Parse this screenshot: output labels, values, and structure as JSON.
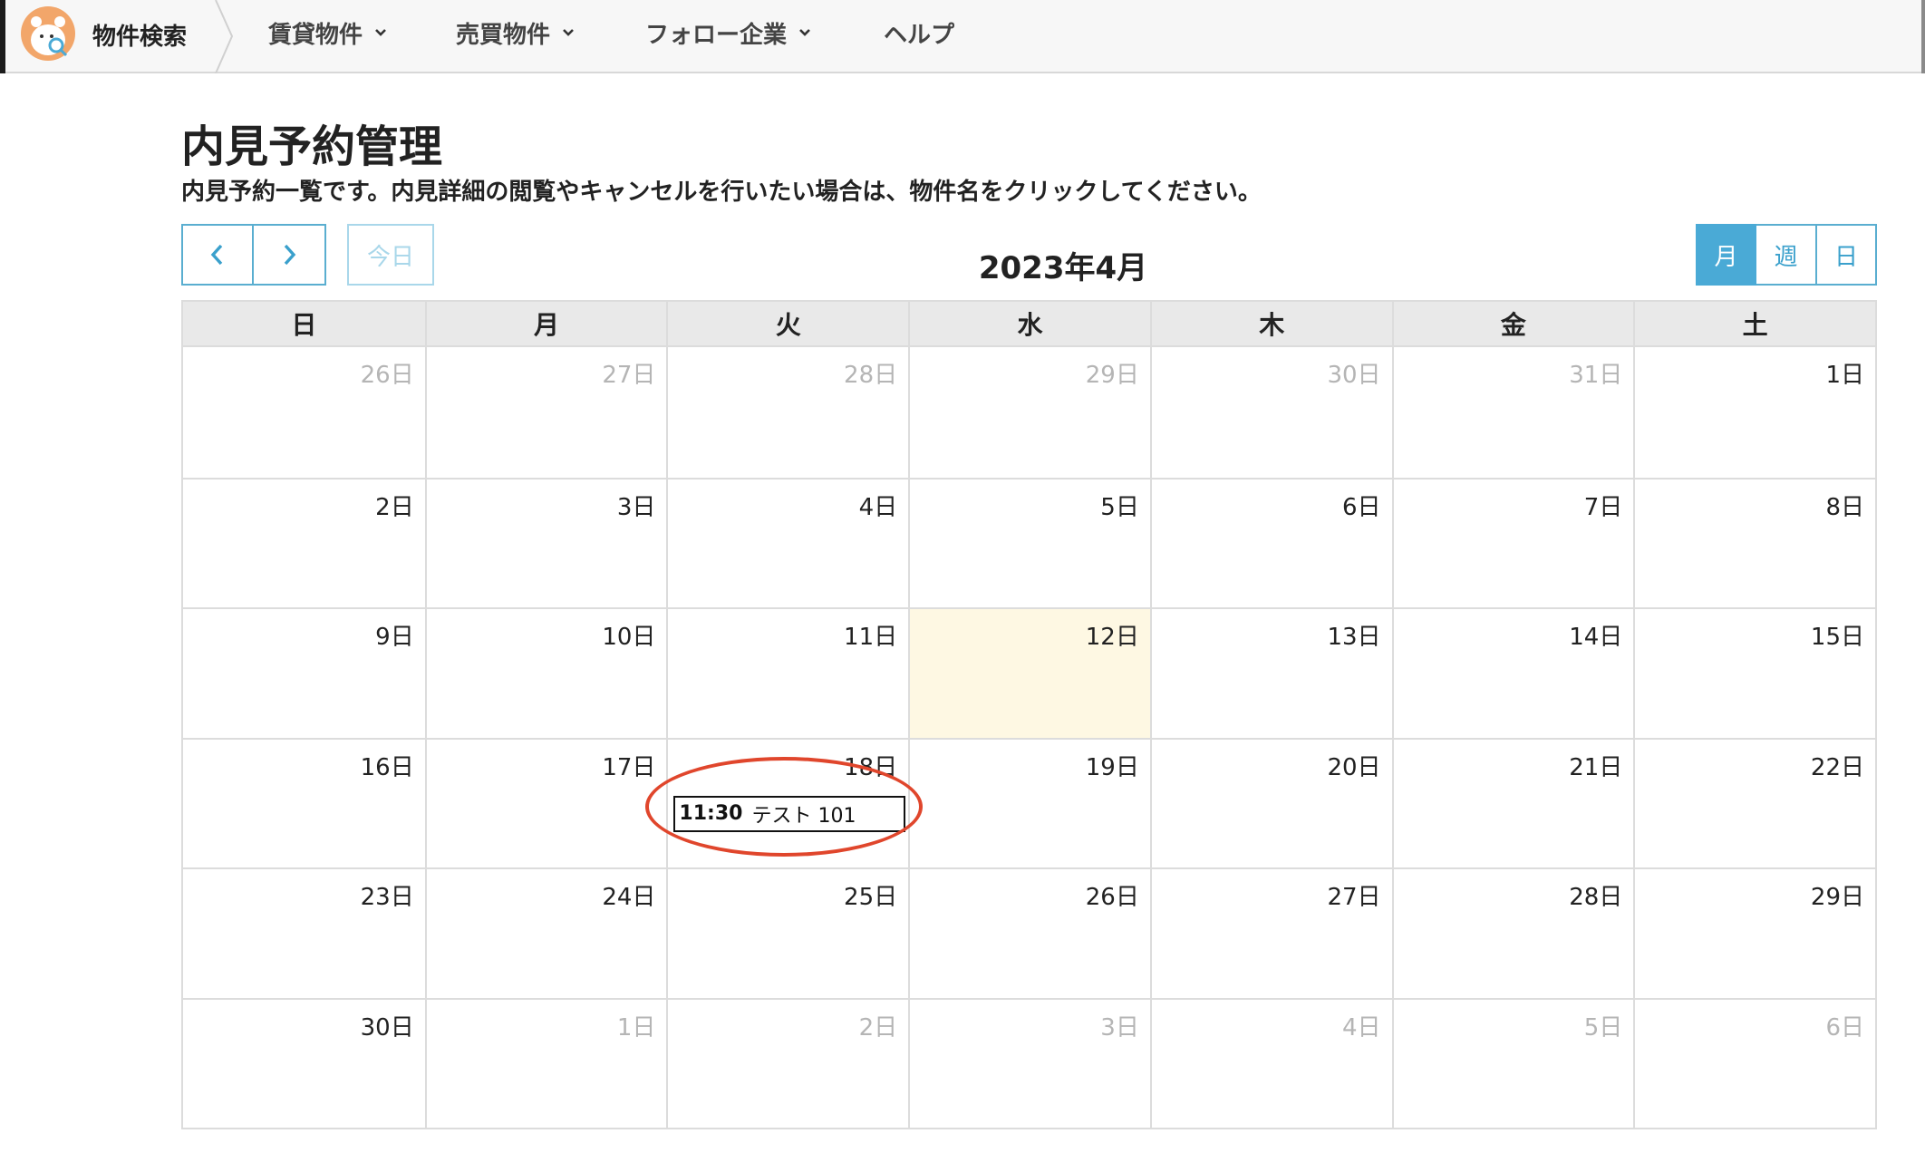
{
  "nav": {
    "brand_title": "物件検索",
    "items": [
      {
        "label": "賃貸物件",
        "has_dropdown": true
      },
      {
        "label": "売買物件",
        "has_dropdown": true
      },
      {
        "label": "フォロー企業",
        "has_dropdown": true
      },
      {
        "label": "ヘルプ",
        "has_dropdown": false
      }
    ]
  },
  "page": {
    "title": "内見予約管理",
    "description": "内見予約一覧です。内見詳細の閲覧やキャンセルを行いたい場合は、物件名をクリックしてください。"
  },
  "toolbar": {
    "prev_icon": "chevron-left-icon",
    "next_icon": "chevron-right-icon",
    "today_label": "今日",
    "title": "2023年4月",
    "views": [
      {
        "label": "月",
        "active": true
      },
      {
        "label": "週",
        "active": false
      },
      {
        "label": "日",
        "active": false
      }
    ]
  },
  "calendar": {
    "weekdays": [
      "日",
      "月",
      "火",
      "水",
      "木",
      "金",
      "土"
    ],
    "weeks": [
      [
        {
          "label": "26日",
          "muted": true
        },
        {
          "label": "27日",
          "muted": true
        },
        {
          "label": "28日",
          "muted": true
        },
        {
          "label": "29日",
          "muted": true
        },
        {
          "label": "30日",
          "muted": true
        },
        {
          "label": "31日",
          "muted": true
        },
        {
          "label": "1日",
          "muted": false
        }
      ],
      [
        {
          "label": "2日"
        },
        {
          "label": "3日"
        },
        {
          "label": "4日"
        },
        {
          "label": "5日"
        },
        {
          "label": "6日"
        },
        {
          "label": "7日"
        },
        {
          "label": "8日"
        }
      ],
      [
        {
          "label": "9日"
        },
        {
          "label": "10日"
        },
        {
          "label": "11日"
        },
        {
          "label": "12日",
          "today": true
        },
        {
          "label": "13日"
        },
        {
          "label": "14日"
        },
        {
          "label": "15日"
        }
      ],
      [
        {
          "label": "16日"
        },
        {
          "label": "17日"
        },
        {
          "label": "18日",
          "event": {
            "time": "11:30",
            "title": "テスト 101"
          }
        },
        {
          "label": "19日"
        },
        {
          "label": "20日"
        },
        {
          "label": "21日"
        },
        {
          "label": "22日"
        }
      ],
      [
        {
          "label": "23日"
        },
        {
          "label": "24日"
        },
        {
          "label": "25日"
        },
        {
          "label": "26日"
        },
        {
          "label": "27日"
        },
        {
          "label": "28日"
        },
        {
          "label": "29日"
        }
      ],
      [
        {
          "label": "30日"
        },
        {
          "label": "1日",
          "muted": true
        },
        {
          "label": "2日",
          "muted": true
        },
        {
          "label": "3日",
          "muted": true
        },
        {
          "label": "4日",
          "muted": true
        },
        {
          "label": "5日",
          "muted": true
        },
        {
          "label": "6日",
          "muted": true
        }
      ]
    ]
  },
  "colors": {
    "accent": "#4aaad6",
    "today_bg": "#fef8e3",
    "annotation_ring": "#e0462c"
  }
}
